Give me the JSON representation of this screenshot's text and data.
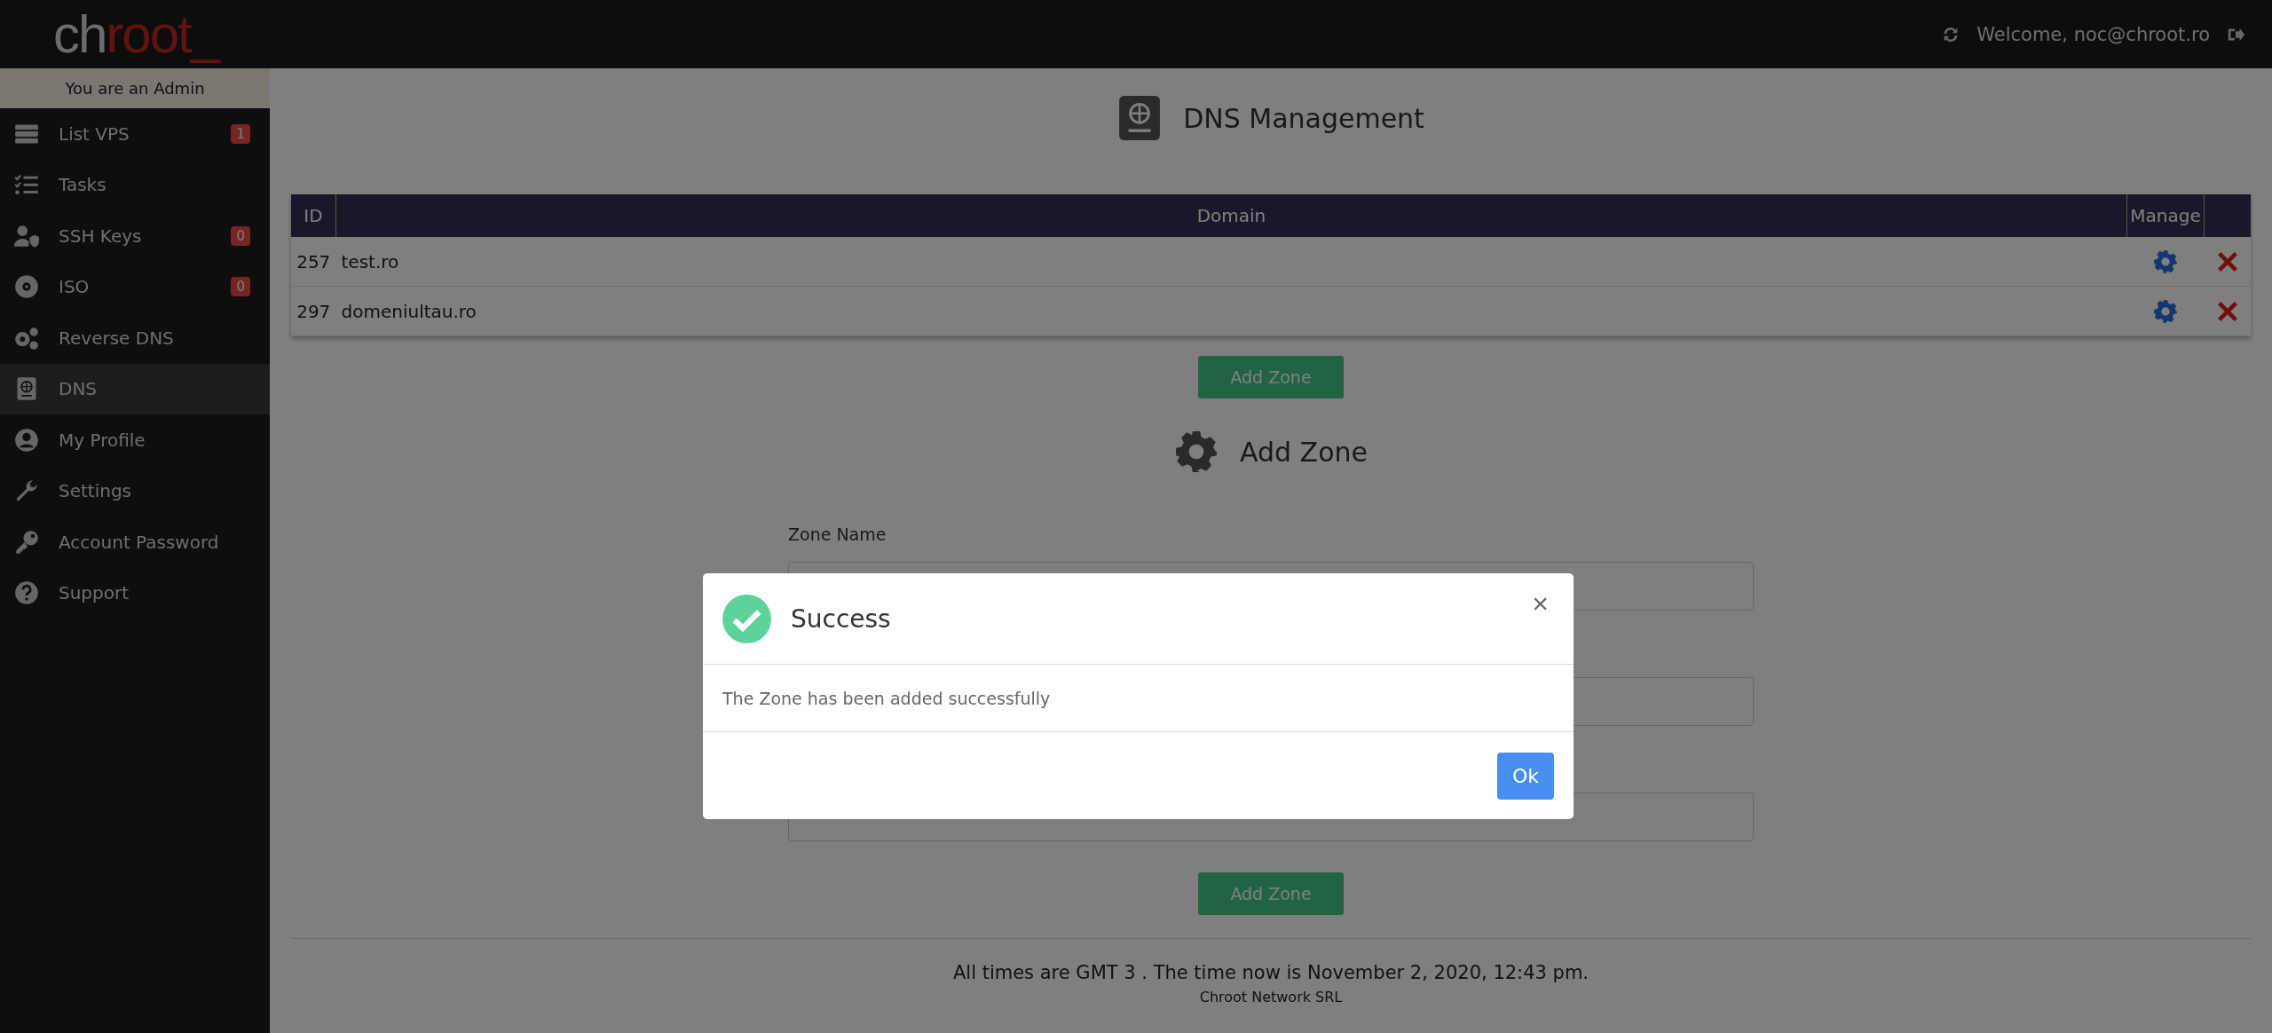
{
  "header": {
    "logo_left": "ch",
    "logo_right": "root_",
    "welcome": "Welcome, noc@chroot.ro"
  },
  "sidebar": {
    "role_banner": "You are an Admin",
    "items": [
      {
        "label": "List VPS",
        "badge": "1",
        "selected": false
      },
      {
        "label": "Tasks",
        "selected": false
      },
      {
        "label": "SSH Keys",
        "badge": "0",
        "selected": false
      },
      {
        "label": "ISO",
        "badge": "0",
        "selected": false
      },
      {
        "label": "Reverse DNS",
        "selected": false
      },
      {
        "label": "DNS",
        "selected": true
      },
      {
        "label": "My Profile",
        "selected": false
      },
      {
        "label": "Settings",
        "selected": false
      },
      {
        "label": "Account Password",
        "selected": false
      },
      {
        "label": "Support",
        "selected": false
      }
    ]
  },
  "page_title": "DNS Management",
  "table": {
    "columns": [
      "ID",
      "Domain",
      "Manage"
    ],
    "rows": [
      {
        "id": "257",
        "domain": "test.ro"
      },
      {
        "id": "297",
        "domain": "domeniultau.ro"
      }
    ]
  },
  "add_zone_button": "Add Zone",
  "form": {
    "title": "Add Zone",
    "fields": [
      {
        "kind": "text",
        "label": "Zone Name"
      },
      {
        "kind": "text"
      },
      {
        "kind": "text"
      }
    ],
    "submit": "Add Zone"
  },
  "footer": {
    "time_note": "All times are GMT 3 . The time now is November 2, 2020, 12:43 pm.",
    "company": "Chroot Network SRL"
  },
  "modal": {
    "title": "Success",
    "close": "×",
    "message": "The Zone has been added successfully",
    "ok": "Ok"
  }
}
